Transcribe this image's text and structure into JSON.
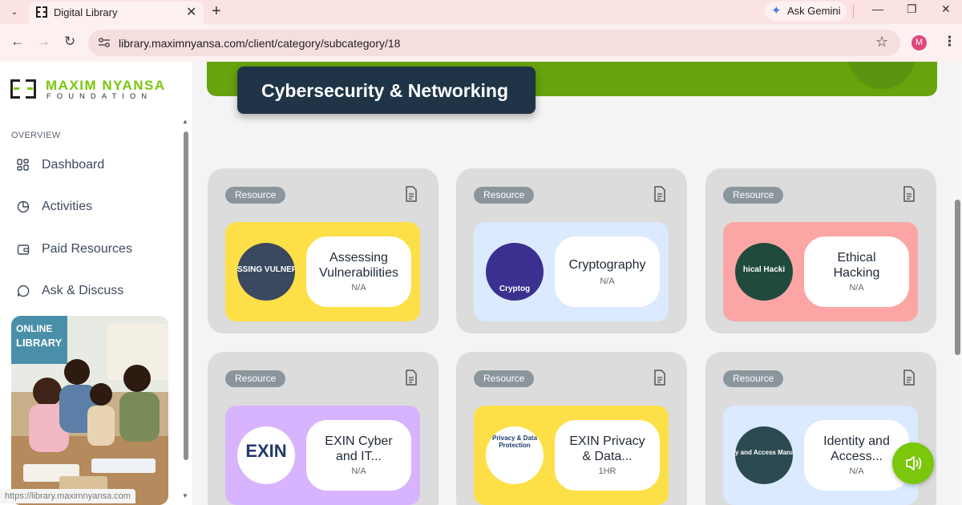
{
  "browser": {
    "tab_title": "Digital Library",
    "gemini_label": "Ask Gemini",
    "url": "library.maximnyansa.com/client/category/subcategory/18",
    "profile_initial": "M",
    "status_url": "https://library.maximnyansa.com"
  },
  "sidebar": {
    "logo_line1": "MAXIM NYANSA",
    "logo_line2": "FOUNDATION",
    "section_label": "OVERVIEW",
    "items": [
      {
        "label": "Dashboard",
        "icon": "dashboard-grid-icon"
      },
      {
        "label": "Activities",
        "icon": "pie-chart-icon"
      },
      {
        "label": "Paid Resources",
        "icon": "wallet-icon"
      },
      {
        "label": "Ask & Discuss",
        "icon": "chat-bubble-icon"
      }
    ],
    "promo_image_text": "ONLINE LIBRARY"
  },
  "main": {
    "page_title": "Cybersecurity & Networking",
    "cards": [
      {
        "badge": "Resource",
        "title_line1": "Assessing",
        "title_line2": "Vulnerabilities",
        "meta": "N/A",
        "thumb_text": "SSING VULNERABI",
        "color": "#fde047"
      },
      {
        "badge": "Resource",
        "title_line1": "Cryptography",
        "title_line2": "",
        "meta": "N/A",
        "thumb_text": "Cryptog",
        "color": "#dbeafe"
      },
      {
        "badge": "Resource",
        "title_line1": "Ethical",
        "title_line2": "Hacking",
        "meta": "N/A",
        "thumb_text": "hical Hacki",
        "color": "#fca5a5"
      },
      {
        "badge": "Resource",
        "title_line1": "EXIN Cyber",
        "title_line2": "and IT...",
        "meta": "N/A",
        "thumb_text": "EXIN",
        "color": "#d8b4fe"
      },
      {
        "badge": "Resource",
        "title_line1": "EXIN Privacy",
        "title_line2": "& Data...",
        "meta": "1HR",
        "thumb_text": "Privacy & Data Protection",
        "color": "#fde047"
      },
      {
        "badge": "Resource",
        "title_line1": "Identity and",
        "title_line2": "Access...",
        "meta": "N/A",
        "thumb_text": "y and Access Manag",
        "color": "#dbeafe"
      }
    ]
  },
  "colors": {
    "brand_green": "#7ac70c",
    "hero_green": "#66a30d",
    "title_navy": "#1f3446"
  }
}
